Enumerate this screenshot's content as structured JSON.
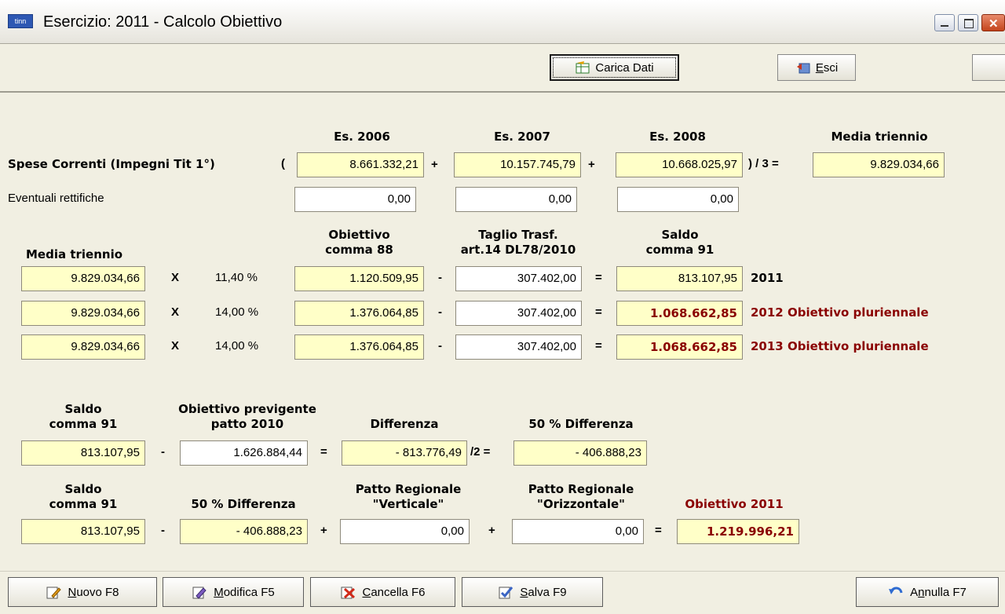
{
  "window": {
    "app_icon_text": "tinn",
    "title": "Esercizio: 2011 - Calcolo Obiettivo"
  },
  "toolbar": {
    "carica_label": "Carica Dati",
    "esci_label": "Esci"
  },
  "years_header": {
    "col1": "Es. 2006",
    "col2": "Es. 2007",
    "col3": "Es. 2008",
    "media": "Media triennio"
  },
  "spese": {
    "label": "Spese Correnti (Impegni Tit 1°)",
    "open_paren": "(",
    "plus1": "+",
    "plus2": "+",
    "div3": ") / 3 =",
    "v2006": "8.661.332,21",
    "v2007": "10.157.745,79",
    "v2008": "10.668.025,97",
    "media": "9.829.034,66"
  },
  "rettifiche": {
    "label": "Eventuali rettifiche",
    "v2006": "0,00",
    "v2007": "0,00",
    "v2008": "0,00"
  },
  "obiettivo_header": {
    "media": "Media triennio",
    "obiettivo_l1": "Obiettivo",
    "obiettivo_l2": "comma 88",
    "taglio_l1": "Taglio Trasf.",
    "taglio_l2": "art.14 DL78/2010",
    "saldo_l1": "Saldo",
    "saldo_l2": "comma 91"
  },
  "rows": [
    {
      "media": "9.829.034,66",
      "times": "X",
      "pct": "11,40 %",
      "obiettivo": "1.120.509,95",
      "minus": "-",
      "taglio": "307.402,00",
      "eq": "=",
      "saldo": "813.107,95",
      "label": "2011"
    },
    {
      "media": "9.829.034,66",
      "times": "X",
      "pct": "14,00 %",
      "obiettivo": "1.376.064,85",
      "minus": "-",
      "taglio": "307.402,00",
      "eq": "=",
      "saldo": "1.068.662,85",
      "label": "2012 Obiettivo pluriennale"
    },
    {
      "media": "9.829.034,66",
      "times": "X",
      "pct": "14,00 %",
      "obiettivo": "1.376.064,85",
      "minus": "-",
      "taglio": "307.402,00",
      "eq": "=",
      "saldo": "1.068.662,85",
      "label": "2013 Obiettivo pluriennale"
    }
  ],
  "diff_header": {
    "saldo_l1": "Saldo",
    "saldo_l2": "comma 91",
    "prev_l1": "Obiettivo previgente",
    "prev_l2": "patto 2010",
    "differenza": "Differenza",
    "meta": "50 % Differenza"
  },
  "diff_row": {
    "saldo": "813.107,95",
    "minus": "-",
    "previgente": "1.626.884,44",
    "eq": "=",
    "differenza": "- 813.776,49",
    "div2": "/2 =",
    "meta": "- 406.888,23"
  },
  "final_header": {
    "saldo_l1": "Saldo",
    "saldo_l2": "comma 91",
    "meta": "50 % Differenza",
    "vert_l1": "Patto Regionale",
    "vert_l2": "\"Verticale\"",
    "orizz_l1": "Patto Regionale",
    "orizz_l2": "\"Orizzontale\"",
    "obiettivo": "Obiettivo 2011"
  },
  "final_row": {
    "saldo": "813.107,95",
    "minus": "-",
    "meta": "- 406.888,23",
    "plus1": "+",
    "verticale": "0,00",
    "plus2": "+",
    "orizzontale": "0,00",
    "eq": "=",
    "obiettivo": "1.219.996,21"
  },
  "bottom": {
    "nuovo": {
      "key": "N",
      "rest": "uovo F8"
    },
    "modifica": {
      "key": "M",
      "rest": "odifica F5"
    },
    "cancella": {
      "key": "C",
      "rest": "ancella F6"
    },
    "salva": {
      "key": "S",
      "rest": "alva F9"
    },
    "annulla": {
      "pre": "A",
      "key": "n",
      "rest": "nulla F7"
    }
  },
  "colors": {
    "accent_red": "#8a0000",
    "field_yellow": "#ffffc8",
    "bg": "#f1efe2"
  }
}
